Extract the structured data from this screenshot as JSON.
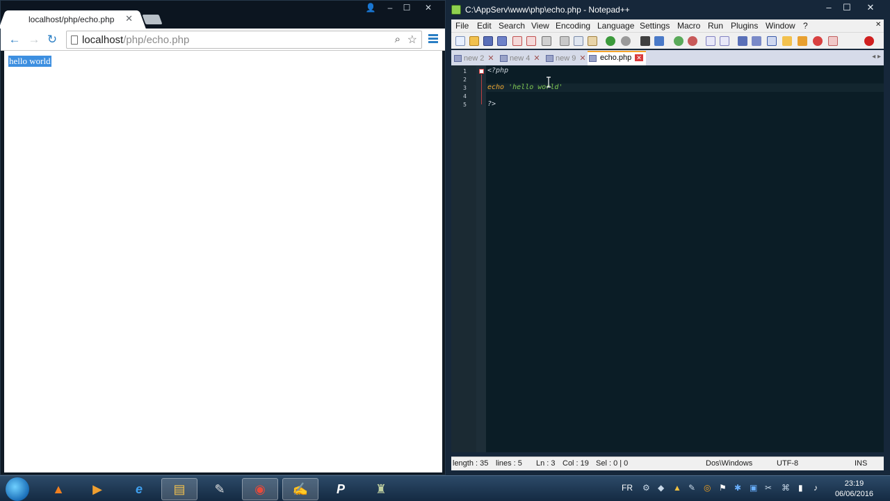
{
  "browser": {
    "tab_title": "localhost/php/echo.php",
    "tab_close": "✕",
    "url_host": "localhost",
    "url_path": "/php/echo.php",
    "page_output": "hello world",
    "controls": {
      "minimize": "‒",
      "maximize": "☐",
      "close": "✕",
      "profile": "👤"
    },
    "icons": {
      "back": "←",
      "forward": "→",
      "reload": "↻",
      "zoom": "⌕",
      "star": "☆"
    }
  },
  "editor": {
    "title": "C:\\AppServ\\www\\php\\echo.php - Notepad++",
    "controls": {
      "minimize": "‒",
      "maximize": "☐",
      "close": "✕"
    },
    "menu": [
      "File",
      "Edit",
      "Search",
      "View",
      "Encoding",
      "Language",
      "Settings",
      "Macro",
      "Run",
      "Plugins",
      "Window",
      "?"
    ],
    "menu_close": "✕",
    "tabs": [
      {
        "label": "new 2",
        "close": "✕",
        "active": false
      },
      {
        "label": "new 4",
        "close": "✕",
        "active": false
      },
      {
        "label": "new 9",
        "close": "✕",
        "active": false
      },
      {
        "label": "echo.php",
        "close": "✕",
        "active": true
      }
    ],
    "tab_arrows": "◂ ▸",
    "lines": [
      {
        "number": "1",
        "text": "<?php"
      },
      {
        "number": "2",
        "text": ""
      },
      {
        "number": "3",
        "text": "echo 'hello world'"
      },
      {
        "number": "4",
        "text": ""
      },
      {
        "number": "5",
        "text": "?>"
      }
    ],
    "status": {
      "length": "length : 35",
      "lines": "lines : 5",
      "ln": "Ln : 3",
      "col": "Col : 19",
      "sel": "Sel : 0 | 0",
      "eol": "Dos\\Windows",
      "encoding": "UTF-8",
      "mode": "INS"
    },
    "colors": {
      "keyword": "#f0a830",
      "string": "#7ec850",
      "php_tag": "#d0d8e0"
    }
  },
  "taskbar": {
    "language": "FR",
    "time": "23:19",
    "date": "06/06/2016",
    "apps": [
      {
        "icon": "vlc-icon",
        "glyph": "▲"
      },
      {
        "icon": "media-player-icon",
        "glyph": "▶"
      },
      {
        "icon": "internet-explorer-icon",
        "glyph": "e"
      },
      {
        "icon": "file-explorer-icon",
        "glyph": "▤"
      },
      {
        "icon": "paint-icon",
        "glyph": "✎"
      },
      {
        "icon": "chrome-icon",
        "glyph": "◉"
      },
      {
        "icon": "notepad-plus-plus-icon",
        "glyph": "✍"
      },
      {
        "icon": "phpstorm-icon",
        "glyph": "P"
      },
      {
        "icon": "app-icon",
        "glyph": "♜"
      }
    ]
  }
}
